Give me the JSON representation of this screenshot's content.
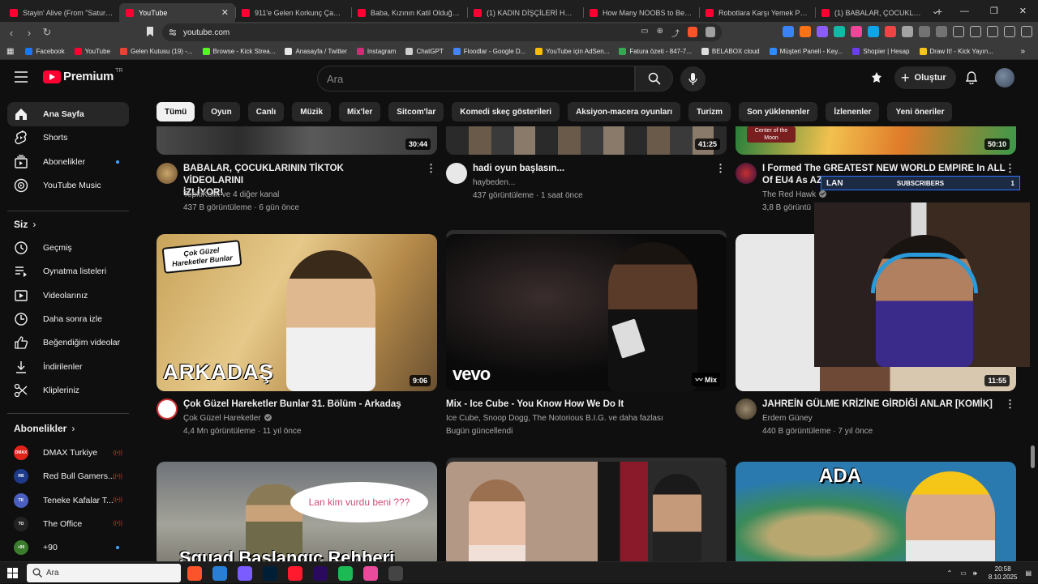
{
  "browser": {
    "tabs": [
      {
        "title": "Stayin' Alive (From \"Saturd...",
        "active": false
      },
      {
        "title": "YouTube",
        "active": true
      },
      {
        "title": "911'e Gelen Korkunç Çağrı - Yo",
        "active": false
      },
      {
        "title": "Baba, Kızının Katil Olduğunu Ö",
        "active": false
      },
      {
        "title": "(1) KADIN DİŞÇİLERİ HEDEF AL",
        "active": false
      },
      {
        "title": "How Many NOOBS to Beat a C",
        "active": false
      },
      {
        "title": "Robotlara Karşı Yemek Pişirdim",
        "active": false
      },
      {
        "title": "(1) BABALAR, ÇOCUKLARININ",
        "active": false
      }
    ],
    "url": "youtube.com",
    "bookmarks": [
      {
        "label": "Facebook",
        "color": "#1877f2"
      },
      {
        "label": "YouTube",
        "color": "#ff0033"
      },
      {
        "label": "Gelen Kutusu (19) -...",
        "color": "#ea4335"
      },
      {
        "label": "Browse - Kick Strea...",
        "color": "#53fc18"
      },
      {
        "label": "Anasayfa / Twitter",
        "color": "#e7e7e7"
      },
      {
        "label": "Instagram",
        "color": "#d62976"
      },
      {
        "label": "ChatGPT",
        "color": "#cfcfcf"
      },
      {
        "label": "Floodlar - Google D...",
        "color": "#4285f4"
      },
      {
        "label": "YouTube için AdSen...",
        "color": "#fbbc04"
      },
      {
        "label": "Fatura özeti - 847-7...",
        "color": "#34a853"
      },
      {
        "label": "BELABOX cloud",
        "color": "#dddddd"
      },
      {
        "label": "Müşteri Paneli - Key...",
        "color": "#2d8cff"
      },
      {
        "label": "Shopier | Hesap",
        "color": "#6b3df5"
      },
      {
        "label": "Draw It! - Kick Yayın...",
        "color": "#f5c518"
      }
    ]
  },
  "header": {
    "brand": "Premium",
    "region": "TR",
    "search_placeholder": "Ara",
    "create_label": "Oluştur"
  },
  "sidebar": {
    "main": [
      {
        "label": "Ana Sayfa",
        "icon": "home-icon",
        "active": true
      },
      {
        "label": "Shorts",
        "icon": "shorts-icon"
      },
      {
        "label": "Abonelikler",
        "icon": "subscriptions-icon",
        "dot": true
      },
      {
        "label": "YouTube Music",
        "icon": "music-icon"
      }
    ],
    "you_heading": "Siz",
    "you": [
      {
        "label": "Geçmiş",
        "icon": "history-icon"
      },
      {
        "label": "Oynatma listeleri",
        "icon": "playlists-icon"
      },
      {
        "label": "Videolarınız",
        "icon": "your-videos-icon"
      },
      {
        "label": "Daha sonra izle",
        "icon": "watch-later-icon"
      },
      {
        "label": "Beğendiğim videolar",
        "icon": "like-icon"
      },
      {
        "label": "İndirilenler",
        "icon": "download-icon"
      },
      {
        "label": "Klipleriniz",
        "icon": "clips-icon"
      }
    ],
    "subs_heading": "Abonelikler",
    "subs": [
      {
        "label": "DMAX Turkiye",
        "avatar_text": "DMAX",
        "avatar_color": "#e2231a",
        "live": true
      },
      {
        "label": "Red Bull Gamers...",
        "avatar_text": "RB",
        "avatar_color": "#1e3a8a",
        "live": true
      },
      {
        "label": "Teneke Kafalar T...",
        "avatar_text": "TK",
        "avatar_color": "#4b5fc0",
        "live": true
      },
      {
        "label": "The Office",
        "avatar_text": "TO",
        "avatar_color": "#222222",
        "live": true
      },
      {
        "label": "+90",
        "avatar_text": "+90",
        "avatar_color": "#3a7d2c",
        "dot": true
      }
    ]
  },
  "chips": [
    "Tümü",
    "Oyun",
    "Canlı",
    "Müzik",
    "Mix'ler",
    "Sitcom'lar",
    "Komedi skeç gösterileri",
    "Aksiyon-macera oyunları",
    "Turizm",
    "Son yüklenenler",
    "İzlenenler",
    "Yeni öneriler"
  ],
  "videos_row1": [
    {
      "title_l1": "BABALAR, ÇOCUKLARININ TİKTOK VİDEOLARINI",
      "title_l2": "İZLİYOR!",
      "channel": "TepkiKolik ve 4 diğer kanal",
      "meta": "437 B görüntüleme · 6 gün önce",
      "duration": "30:44",
      "verified": false
    },
    {
      "title_l1": "hadi oyun başlasın...",
      "title_l2": "",
      "channel": "haybeden...",
      "meta": "437 görüntüleme · 1 saat önce",
      "duration": "41:25",
      "verified": false
    },
    {
      "title_l1": "I Formed The GREATEST NEW WORLD EMPIRE In ALL",
      "title_l2": "Of EU4 As AZ",
      "channel": "The Red Hawk",
      "meta": "3,8 B görüntü",
      "duration": "50:10",
      "verified": true,
      "thumb_label": "Center of the Moon"
    }
  ],
  "videos_row2": [
    {
      "title_l1": "Çok Güzel Hareketler Bunlar 31. Bölüm - Arkadaş",
      "title_l2": "",
      "channel": "Çok Güzel Hareketler",
      "meta": "4,4 Mn görüntüleme · 11 yıl önce",
      "duration": "9:06",
      "verified": true,
      "thumb_text": "ARKADAŞ",
      "logo_text": "Çok Güzel Hareketler Bunlar"
    },
    {
      "title_l1": "Mix - Ice Cube - You Know How We Do It",
      "title_l2": "",
      "channel": "Ice Cube, Snoop Dogg, The Notorious B.I.G. ve daha fazlası",
      "meta": "Bugün güncellendi",
      "duration": "Mix",
      "verified": false,
      "thumb_text": "vevo"
    },
    {
      "title_l1": "JAHREİN GÜLME KRİZİNE GİRDİĞİ ANLAR [KOMİK]",
      "title_l2": "",
      "channel": "Erdem Güney",
      "meta": "440 B görüntüleme · 7 yıl önce",
      "duration": "11:55",
      "verified": false
    }
  ],
  "videos_row3": [
    {
      "bubble": "Lan kim vurdu beni ???",
      "thumb_text": "Squad Başlangıç Rehberi"
    },
    {},
    {
      "thumb_text": "ADA"
    }
  ],
  "overlay": {
    "label": "SUBSCRIBERS",
    "count": "1",
    "tail": "LAN"
  },
  "taskbar": {
    "search": "Ara",
    "time": "20:58",
    "date": "8.10.2025",
    "apps": [
      {
        "name": "brave-app",
        "color": "#fb542b"
      },
      {
        "name": "app-2",
        "color": "#2a7fd4"
      },
      {
        "name": "app-3",
        "color": "#7a5cff"
      },
      {
        "name": "photoshop-app",
        "color": "#001e36"
      },
      {
        "name": "opera-app",
        "color": "#ff1b2d"
      },
      {
        "name": "premiere-app",
        "color": "#2a0a5e"
      },
      {
        "name": "spotify-app",
        "color": "#1db954"
      },
      {
        "name": "app-8",
        "color": "#e84a9c"
      },
      {
        "name": "obs-app",
        "color": "#444444"
      }
    ]
  }
}
